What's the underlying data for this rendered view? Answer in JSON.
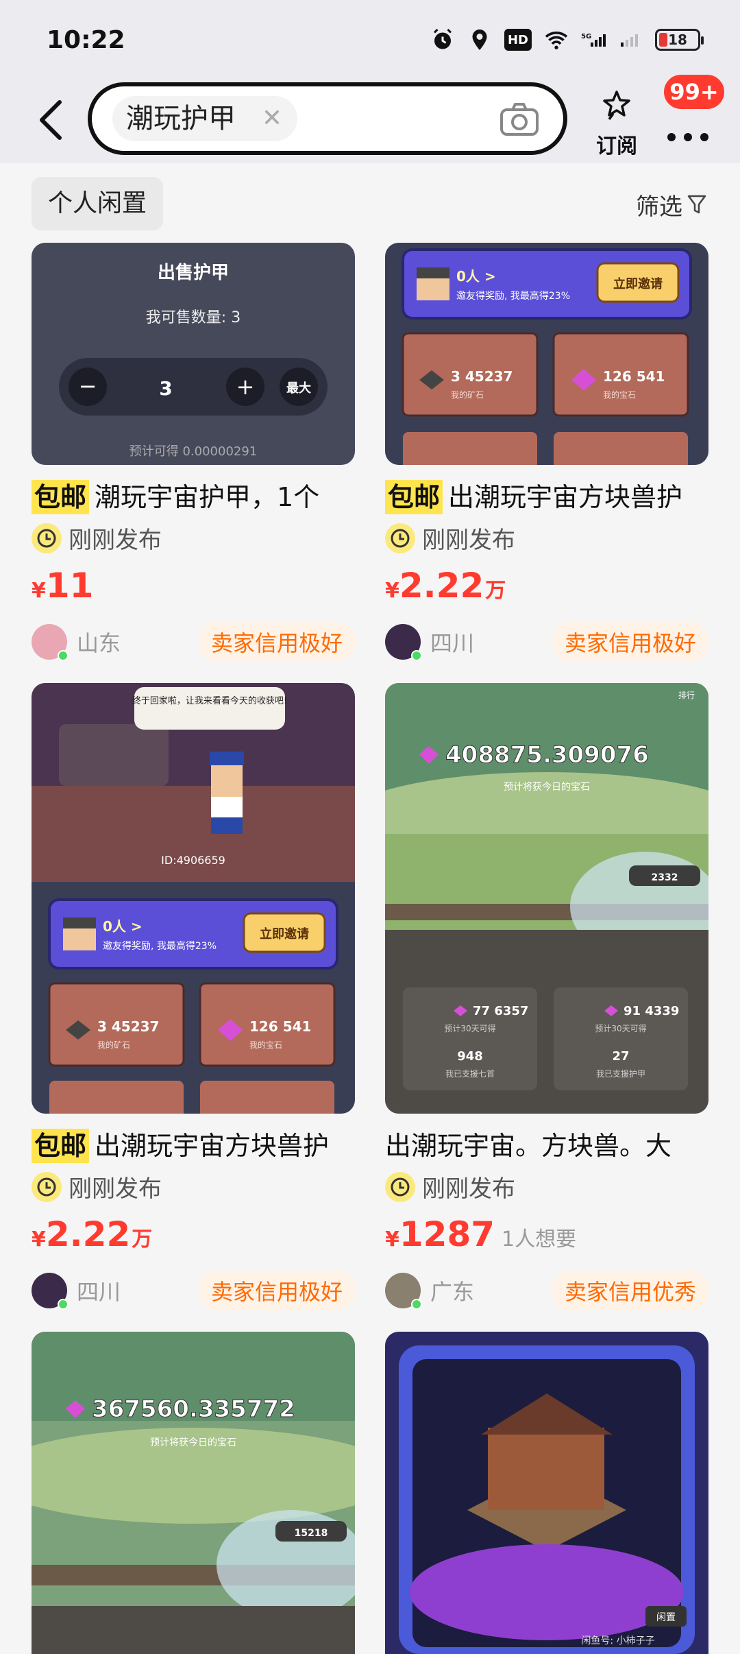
{
  "status_bar": {
    "time": "10:22",
    "hd": "HD",
    "network": "5G",
    "battery": "18"
  },
  "header": {
    "search_term": "潮玩护甲",
    "subscribe_label": "订阅",
    "badge": "99+"
  },
  "filters": {
    "personal": "个人闲置",
    "filter_label": "筛选"
  },
  "cards": [
    {
      "free_ship": "包邮",
      "title": "潮玩宇宙护甲，1个",
      "time": "刚刚发布",
      "price_symbol": "¥",
      "price": "11",
      "price_unit": "",
      "want": "",
      "region": "山东",
      "credit": "卖家信用极好",
      "img": {
        "heading": "出售护甲",
        "sell_count_label": "我可售数量: 3",
        "qty": "3",
        "max": "最大",
        "estimate": "预计可得 0.00000291"
      }
    },
    {
      "free_ship": "包邮",
      "title": "出潮玩宇宙方块兽护",
      "time": "刚刚发布",
      "price_symbol": "¥",
      "price": "2.22",
      "price_unit": "万",
      "want": "",
      "region": "四川",
      "credit": "卖家信用极好",
      "img": {
        "people": "0人 >",
        "invite_text": "邀友得奖励, 我最高得23%",
        "invite_btn": "立即邀请",
        "ore_value": "3 45237",
        "ore_label": "我的矿石",
        "gem_value": "126 541",
        "gem_label": "我的宝石"
      }
    },
    {
      "free_ship": "包邮",
      "title": "出潮玩宇宙方块兽护",
      "time": "刚刚发布",
      "price_symbol": "¥",
      "price": "2.22",
      "price_unit": "万",
      "want": "",
      "region": "四川",
      "credit": "卖家信用极好",
      "img": {
        "bubble": "终于回家啦，让我来看看今天的收获吧!",
        "id_text": "ID:4906659",
        "people": "0人 >",
        "invite_text": "邀友得奖励, 我最高得23%",
        "invite_btn": "立即邀请",
        "ore_value": "3 45237",
        "ore_label": "我的矿石",
        "gem_value": "126 541",
        "gem_label": "我的宝石"
      }
    },
    {
      "free_ship": "",
      "title": "出潮玩宇宙。方块兽。大",
      "time": "刚刚发布",
      "price_symbol": "¥",
      "price": "1287",
      "price_unit": "",
      "want": "1人想要",
      "region": "广东",
      "credit": "卖家信用优秀",
      "img": {
        "gem_total": "408875.309076",
        "sub": "预计将获今日的宝石",
        "shield": "2332",
        "rank": "排行",
        "stat1": "77 6357",
        "stat1_label": "预计30天可得",
        "stat2": "91 4339",
        "stat2_label": "预计30天可得",
        "stat3": "948",
        "stat3_label": "我已支援七首",
        "stat4": "27",
        "stat4_label": "我已支援护甲"
      }
    },
    {
      "img": {
        "gem_total": "367560.335772",
        "sub": "预计将获今日的宝石",
        "shield": "15218"
      }
    },
    {
      "img": {
        "tag": "闲鱼号: 小柿子子",
        "tag2": "闲置"
      }
    }
  ],
  "colors": {
    "accent": "#ff3b30",
    "credit": "#ff6a00",
    "free_ship_bg": "#ffe44d"
  }
}
